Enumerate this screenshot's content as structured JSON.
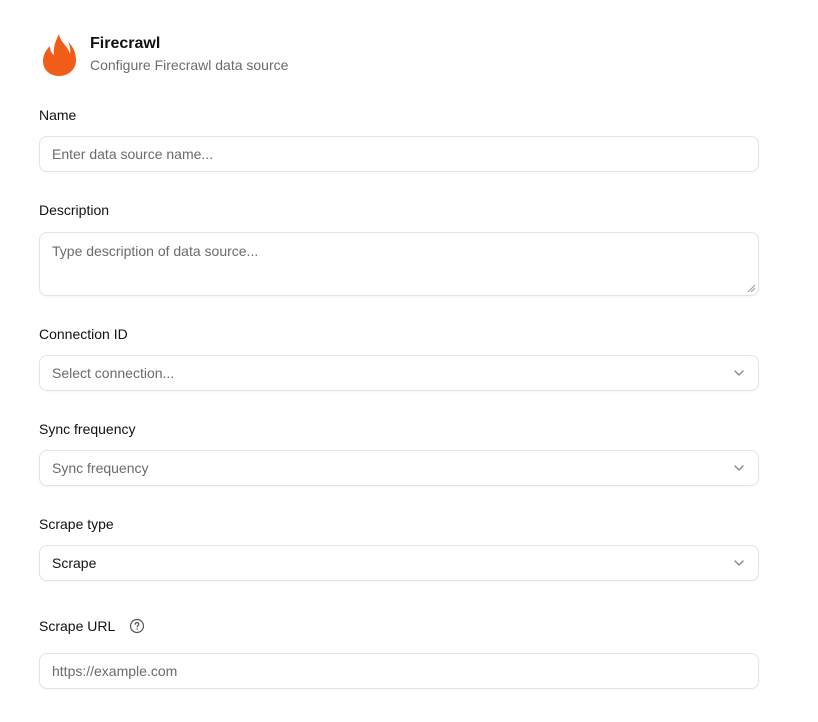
{
  "header": {
    "title": "Firecrawl",
    "subtitle": "Configure Firecrawl data source",
    "icon": "fire-icon",
    "brand_color": "#f25c19"
  },
  "form": {
    "name": {
      "label": "Name",
      "placeholder": "Enter data source name..."
    },
    "description": {
      "label": "Description",
      "placeholder": "Type description of data source..."
    },
    "connection": {
      "label": "Connection ID",
      "placeholder": "Select connection..."
    },
    "sync_frequency": {
      "label": "Sync frequency",
      "placeholder": "Sync frequency"
    },
    "scrape_type": {
      "label": "Scrape type",
      "value": "Scrape"
    },
    "scrape_url": {
      "label": "Scrape URL",
      "placeholder": "https://example.com"
    }
  }
}
